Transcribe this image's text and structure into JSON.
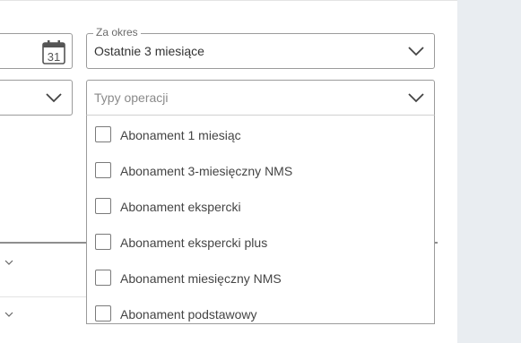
{
  "filters": {
    "period": {
      "legend": "Za okres",
      "value": "Ostatnie 3 miesiące"
    },
    "date_picker": {
      "calendar_day": "31"
    },
    "operation_types": {
      "placeholder": "Typy operacji",
      "options": [
        {
          "label": "Abonament 1 miesiąc",
          "checked": false
        },
        {
          "label": "Abonament 3-miesięczny NMS",
          "checked": false
        },
        {
          "label": "Abonament ekspercki",
          "checked": false
        },
        {
          "label": "Abonament ekspercki plus",
          "checked": false
        },
        {
          "label": "Abonament miesięczny NMS",
          "checked": false
        },
        {
          "label": "Abonament podstawowy",
          "checked": false
        }
      ]
    }
  },
  "icons": {
    "calendar": "calendar-icon",
    "chevron": "chevron-down-icon"
  },
  "colors": {
    "border": "#9b9b9b",
    "text": "#333333",
    "placeholder": "#8a8a8a",
    "gutter": "#e9edf1"
  }
}
